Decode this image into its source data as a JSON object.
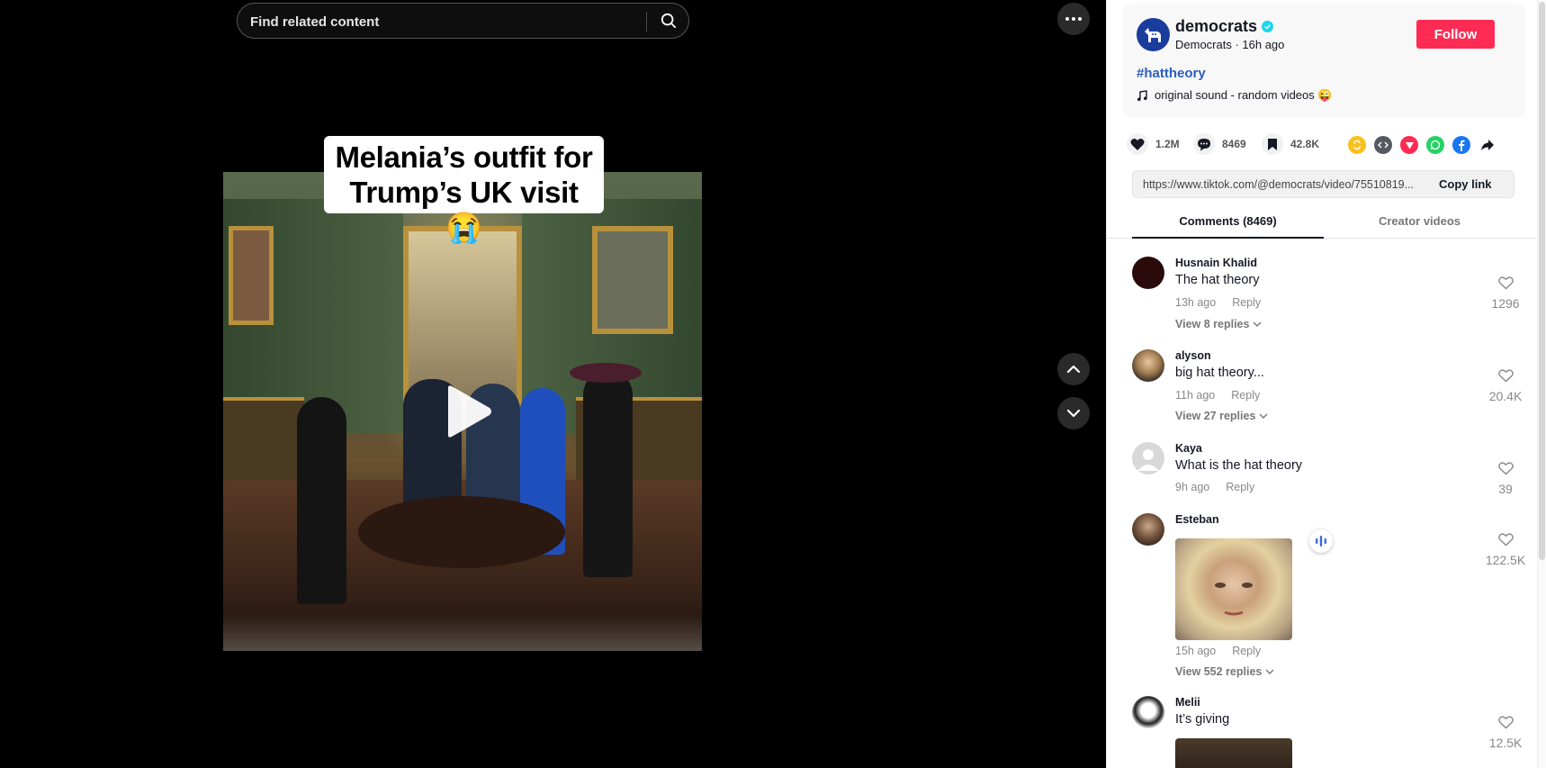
{
  "search": {
    "placeholder": "Find related content"
  },
  "video": {
    "caption_line1": "Melania’s outfit for",
    "caption_line2": "Trump’s UK visit 😭"
  },
  "author": {
    "username": "democrats",
    "subline": "Democrats · 16h ago",
    "follow_label": "Follow",
    "hashtag": "#hattheory",
    "sound": "original sound - random videos 😜"
  },
  "stats": {
    "likes": "1.2M",
    "comments": "8469",
    "saves": "42.8K"
  },
  "link": {
    "url": "https://www.tiktok.com/@democrats/video/75510819...",
    "copy_label": "Copy link"
  },
  "tabs": [
    {
      "label": "Comments (8469)"
    },
    {
      "label": "Creator videos"
    }
  ],
  "comments": [
    {
      "name": "Husnain Khalid",
      "text": "The hat theory",
      "time": "13h ago",
      "reply": "Reply",
      "view": "View 8 replies",
      "likes": "1296"
    },
    {
      "name": "alyson",
      "text": "big hat theory...",
      "time": "11h ago",
      "reply": "Reply",
      "view": "View 27 replies",
      "likes": "20.4K"
    },
    {
      "name": "Kaya",
      "text": "What is the hat theory",
      "time": "9h ago",
      "reply": "Reply",
      "view": "",
      "likes": "39"
    },
    {
      "name": "Esteban",
      "text": "",
      "time": "15h ago",
      "reply": "Reply",
      "view": "View 552 replies",
      "likes": "122.5K"
    },
    {
      "name": "Melii",
      "text": "It’s giving",
      "time": "",
      "reply": "",
      "view": "",
      "likes": "12.5K"
    }
  ],
  "colors": {
    "follow": "#fe2c55",
    "hashtag": "#2b5db9",
    "verified": "#20d5ec"
  }
}
